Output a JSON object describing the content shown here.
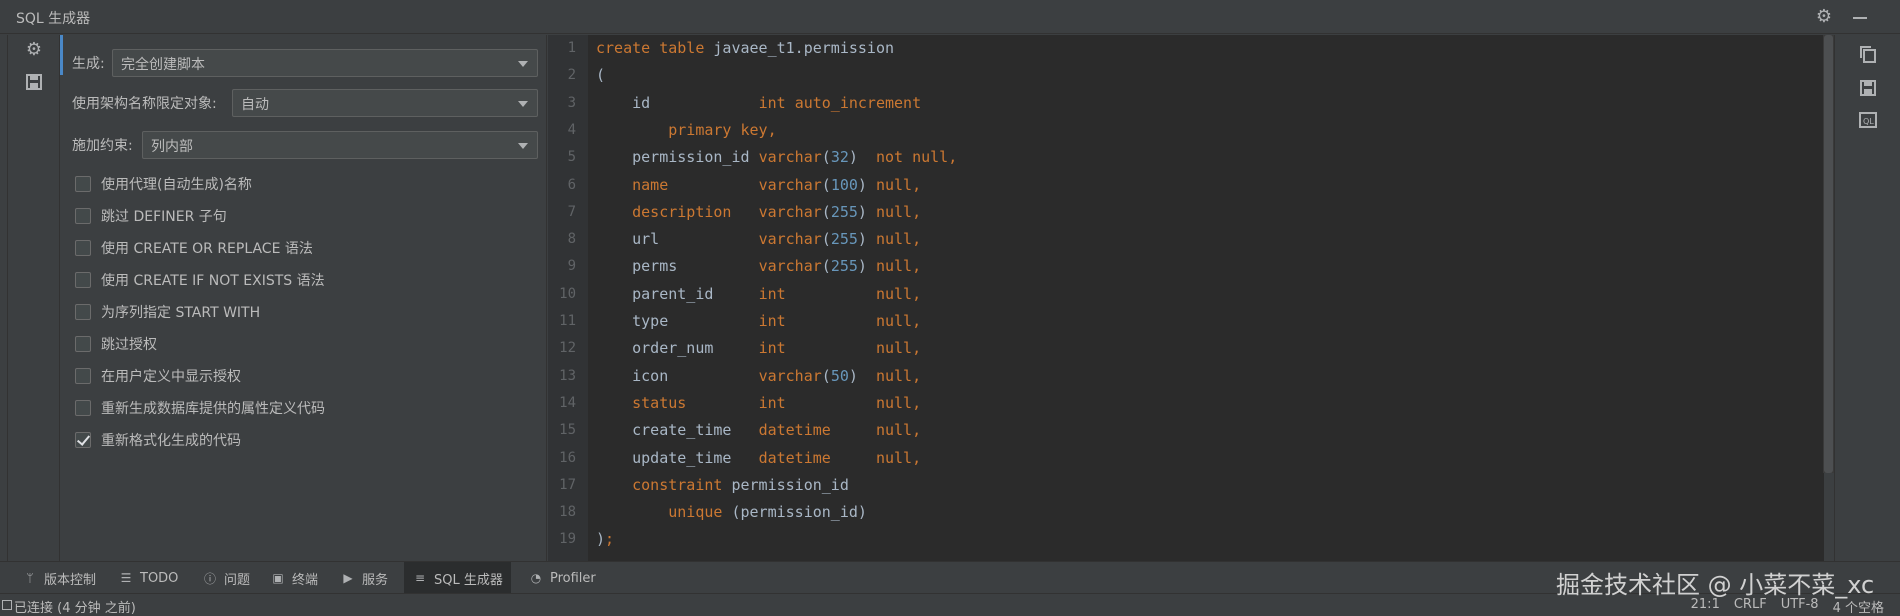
{
  "window": {
    "title": "SQL 生成器",
    "settings_icon": "gear-icon",
    "minimize_icon": "minimize-icon"
  },
  "toolcol": {
    "icons": [
      "gear-icon",
      "save-icon"
    ]
  },
  "options": {
    "generate_label": "生成:",
    "generate_value": "完全创建脚本",
    "schema_label": "使用架构名称限定对象:",
    "schema_value": "自动",
    "constraint_label": "施加约束:",
    "constraint_value": "列内部",
    "checkboxes": [
      {
        "label": "使用代理(自动生成)名称",
        "checked": false
      },
      {
        "label": "跳过 DEFINER 子句",
        "checked": false
      },
      {
        "label": "使用 CREATE OR REPLACE 语法",
        "checked": false
      },
      {
        "label": "使用 CREATE IF NOT EXISTS 语法",
        "checked": false
      },
      {
        "label": "为序列指定 START WITH",
        "checked": false
      },
      {
        "label": "跳过授权",
        "checked": false
      },
      {
        "label": "在用户定义中显示授权",
        "checked": false
      },
      {
        "label": "重新生成数据库提供的属性定义代码",
        "checked": false
      },
      {
        "label": "重新格式化生成的代码",
        "checked": true
      }
    ]
  },
  "editor": {
    "line_numbers": [
      "1",
      "2",
      "3",
      "4",
      "5",
      "6",
      "7",
      "8",
      "9",
      "10",
      "11",
      "12",
      "13",
      "14",
      "15",
      "16",
      "17",
      "18",
      "19"
    ],
    "lines": [
      [
        [
          "kw",
          "create"
        ],
        [
          "plain",
          " "
        ],
        [
          "kw",
          "table"
        ],
        [
          "plain",
          " javaee_t1.permission"
        ]
      ],
      [
        [
          "plain",
          "("
        ]
      ],
      [
        [
          "plain",
          "    id            "
        ],
        [
          "kw",
          "int"
        ],
        [
          "plain",
          " "
        ],
        [
          "kw",
          "auto_increment"
        ]
      ],
      [
        [
          "plain",
          "        "
        ],
        [
          "kw",
          "primary key"
        ],
        [
          "kw",
          ","
        ]
      ],
      [
        [
          "plain",
          "    permission_id "
        ],
        [
          "kw",
          "varchar"
        ],
        [
          "plain",
          "("
        ],
        [
          "num",
          "32"
        ],
        [
          "plain",
          ")  "
        ],
        [
          "kw",
          "not null"
        ],
        [
          "kw",
          ","
        ]
      ],
      [
        [
          "plain",
          "    "
        ],
        [
          "kw",
          "name"
        ],
        [
          "plain",
          "          "
        ],
        [
          "kw",
          "varchar"
        ],
        [
          "plain",
          "("
        ],
        [
          "num",
          "100"
        ],
        [
          "plain",
          ") "
        ],
        [
          "kw",
          "null"
        ],
        [
          "kw",
          ","
        ]
      ],
      [
        [
          "plain",
          "    "
        ],
        [
          "kw",
          "description"
        ],
        [
          "plain",
          "   "
        ],
        [
          "kw",
          "varchar"
        ],
        [
          "plain",
          "("
        ],
        [
          "num",
          "255"
        ],
        [
          "plain",
          ") "
        ],
        [
          "kw",
          "null"
        ],
        [
          "kw",
          ","
        ]
      ],
      [
        [
          "plain",
          "    url           "
        ],
        [
          "kw",
          "varchar"
        ],
        [
          "plain",
          "("
        ],
        [
          "num",
          "255"
        ],
        [
          "plain",
          ") "
        ],
        [
          "kw",
          "null"
        ],
        [
          "kw",
          ","
        ]
      ],
      [
        [
          "plain",
          "    perms         "
        ],
        [
          "kw",
          "varchar"
        ],
        [
          "plain",
          "("
        ],
        [
          "num",
          "255"
        ],
        [
          "plain",
          ") "
        ],
        [
          "kw",
          "null"
        ],
        [
          "kw",
          ","
        ]
      ],
      [
        [
          "plain",
          "    parent_id     "
        ],
        [
          "kw",
          "int"
        ],
        [
          "plain",
          "          "
        ],
        [
          "kw",
          "null"
        ],
        [
          "kw",
          ","
        ]
      ],
      [
        [
          "plain",
          "    type          "
        ],
        [
          "kw",
          "int"
        ],
        [
          "plain",
          "          "
        ],
        [
          "kw",
          "null"
        ],
        [
          "kw",
          ","
        ]
      ],
      [
        [
          "plain",
          "    order_num     "
        ],
        [
          "kw",
          "int"
        ],
        [
          "plain",
          "          "
        ],
        [
          "kw",
          "null"
        ],
        [
          "kw",
          ","
        ]
      ],
      [
        [
          "plain",
          "    icon          "
        ],
        [
          "kw",
          "varchar"
        ],
        [
          "plain",
          "("
        ],
        [
          "num",
          "50"
        ],
        [
          "plain",
          ")  "
        ],
        [
          "kw",
          "null"
        ],
        [
          "kw",
          ","
        ]
      ],
      [
        [
          "plain",
          "    "
        ],
        [
          "kw",
          "status"
        ],
        [
          "plain",
          "        "
        ],
        [
          "kw",
          "int"
        ],
        [
          "plain",
          "          "
        ],
        [
          "kw",
          "null"
        ],
        [
          "kw",
          ","
        ]
      ],
      [
        [
          "plain",
          "    create_time   "
        ],
        [
          "kw",
          "datetime"
        ],
        [
          "plain",
          "     "
        ],
        [
          "kw",
          "null"
        ],
        [
          "kw",
          ","
        ]
      ],
      [
        [
          "plain",
          "    update_time   "
        ],
        [
          "kw",
          "datetime"
        ],
        [
          "plain",
          "     "
        ],
        [
          "kw",
          "null"
        ],
        [
          "kw",
          ","
        ]
      ],
      [
        [
          "plain",
          "    "
        ],
        [
          "kw",
          "constraint"
        ],
        [
          "plain",
          " permission_id"
        ]
      ],
      [
        [
          "plain",
          "        "
        ],
        [
          "kw",
          "unique"
        ],
        [
          "plain",
          " (permission_id)"
        ]
      ],
      [
        [
          "plain",
          ")"
        ],
        [
          "kw",
          ";"
        ]
      ]
    ]
  },
  "righttools": {
    "icons": [
      "copy-icon",
      "save-icon",
      "ql-icon"
    ]
  },
  "bottombar": {
    "tabs": [
      {
        "label": "版本控制",
        "icon": "branch-icon"
      },
      {
        "label": "TODO",
        "icon": "list-icon"
      },
      {
        "label": "问题",
        "icon": "info-icon"
      },
      {
        "label": "终端",
        "icon": "terminal-icon"
      },
      {
        "label": "服务",
        "icon": "play-icon"
      },
      {
        "label": "SQL 生成器",
        "icon": "database-icon"
      },
      {
        "label": "Profiler",
        "icon": "profiler-icon"
      }
    ]
  },
  "statusbar": {
    "connection": "已连接 (4 分钟 之前)",
    "position": "21:1",
    "line_ending": "CRLF",
    "encoding": "UTF-8",
    "indent": "4 个空格"
  },
  "watermark": "掘金技术社区 @ 小菜不菜_xc"
}
